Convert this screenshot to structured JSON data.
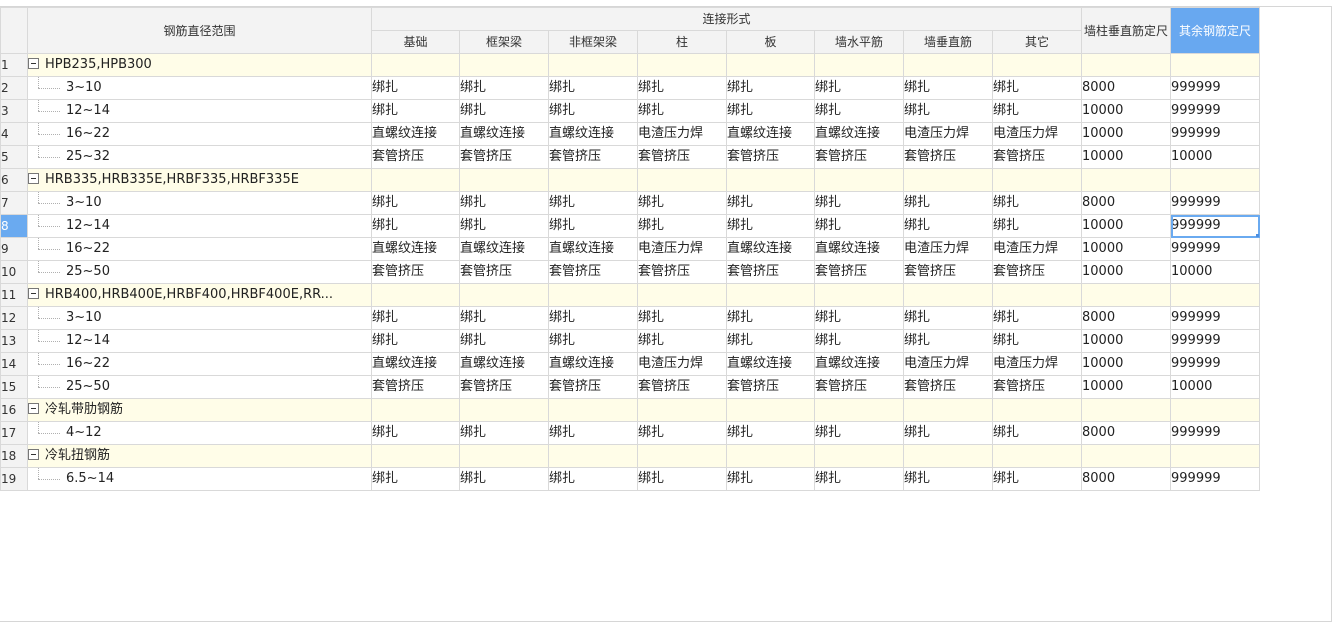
{
  "header": {
    "range_label": "钢筋直径范围",
    "conn_group_label": "连接形式",
    "conn_columns": [
      "基础",
      "框架梁",
      "非框架梁",
      "柱",
      "板",
      "墙水平筋",
      "墙垂直筋",
      "其它"
    ],
    "wall_col_label": "墙柱垂直筋定尺",
    "rest_col_label": "其余钢筋定尺"
  },
  "rows": [
    {
      "num": "1",
      "type": "group",
      "name": "HPB235,HPB300"
    },
    {
      "num": "2",
      "type": "item",
      "name": "3~10",
      "cells": [
        "绑扎",
        "绑扎",
        "绑扎",
        "绑扎",
        "绑扎",
        "绑扎",
        "绑扎",
        "绑扎",
        "8000",
        "999999"
      ]
    },
    {
      "num": "3",
      "type": "item",
      "name": "12~14",
      "cells": [
        "绑扎",
        "绑扎",
        "绑扎",
        "绑扎",
        "绑扎",
        "绑扎",
        "绑扎",
        "绑扎",
        "10000",
        "999999"
      ]
    },
    {
      "num": "4",
      "type": "item",
      "name": "16~22",
      "cells": [
        "直螺纹连接",
        "直螺纹连接",
        "直螺纹连接",
        "电渣压力焊",
        "直螺纹连接",
        "直螺纹连接",
        "电渣压力焊",
        "电渣压力焊",
        "10000",
        "999999"
      ]
    },
    {
      "num": "5",
      "type": "item",
      "name": "25~32",
      "cells": [
        "套管挤压",
        "套管挤压",
        "套管挤压",
        "套管挤压",
        "套管挤压",
        "套管挤压",
        "套管挤压",
        "套管挤压",
        "10000",
        "10000"
      ]
    },
    {
      "num": "6",
      "type": "group",
      "name": "HRB335,HRB335E,HRBF335,HRBF335E"
    },
    {
      "num": "7",
      "type": "item",
      "name": "3~10",
      "cells": [
        "绑扎",
        "绑扎",
        "绑扎",
        "绑扎",
        "绑扎",
        "绑扎",
        "绑扎",
        "绑扎",
        "8000",
        "999999"
      ]
    },
    {
      "num": "8",
      "type": "item",
      "name": "12~14",
      "selected": true,
      "cells": [
        "绑扎",
        "绑扎",
        "绑扎",
        "绑扎",
        "绑扎",
        "绑扎",
        "绑扎",
        "绑扎",
        "10000",
        "999999"
      ]
    },
    {
      "num": "9",
      "type": "item",
      "name": "16~22",
      "cells": [
        "直螺纹连接",
        "直螺纹连接",
        "直螺纹连接",
        "电渣压力焊",
        "直螺纹连接",
        "直螺纹连接",
        "电渣压力焊",
        "电渣压力焊",
        "10000",
        "999999"
      ]
    },
    {
      "num": "10",
      "type": "item",
      "name": "25~50",
      "cells": [
        "套管挤压",
        "套管挤压",
        "套管挤压",
        "套管挤压",
        "套管挤压",
        "套管挤压",
        "套管挤压",
        "套管挤压",
        "10000",
        "10000"
      ]
    },
    {
      "num": "11",
      "type": "group",
      "name": "HRB400,HRB400E,HRBF400,HRBF400E,RR..."
    },
    {
      "num": "12",
      "type": "item",
      "name": "3~10",
      "cells": [
        "绑扎",
        "绑扎",
        "绑扎",
        "绑扎",
        "绑扎",
        "绑扎",
        "绑扎",
        "绑扎",
        "8000",
        "999999"
      ]
    },
    {
      "num": "13",
      "type": "item",
      "name": "12~14",
      "cells": [
        "绑扎",
        "绑扎",
        "绑扎",
        "绑扎",
        "绑扎",
        "绑扎",
        "绑扎",
        "绑扎",
        "10000",
        "999999"
      ]
    },
    {
      "num": "14",
      "type": "item",
      "name": "16~22",
      "cells": [
        "直螺纹连接",
        "直螺纹连接",
        "直螺纹连接",
        "电渣压力焊",
        "直螺纹连接",
        "直螺纹连接",
        "电渣压力焊",
        "电渣压力焊",
        "10000",
        "999999"
      ]
    },
    {
      "num": "15",
      "type": "item",
      "name": "25~50",
      "cells": [
        "套管挤压",
        "套管挤压",
        "套管挤压",
        "套管挤压",
        "套管挤压",
        "套管挤压",
        "套管挤压",
        "套管挤压",
        "10000",
        "10000"
      ]
    },
    {
      "num": "16",
      "type": "group",
      "name": "冷轧带肋钢筋"
    },
    {
      "num": "17",
      "type": "item",
      "name": "4~12",
      "cells": [
        "绑扎",
        "绑扎",
        "绑扎",
        "绑扎",
        "绑扎",
        "绑扎",
        "绑扎",
        "绑扎",
        "8000",
        "999999"
      ]
    },
    {
      "num": "18",
      "type": "group",
      "name": "冷轧扭钢筋"
    },
    {
      "num": "19",
      "type": "item",
      "name": "6.5~14",
      "cells": [
        "绑扎",
        "绑扎",
        "绑扎",
        "绑扎",
        "绑扎",
        "绑扎",
        "绑扎",
        "绑扎",
        "8000",
        "999999"
      ]
    }
  ],
  "icons": {
    "expander": "collapse-minus-icon"
  },
  "colors": {
    "header_bg": "#f3f3f3",
    "group_row_bg": "#fffde8",
    "selection": "#6aaaf0"
  }
}
